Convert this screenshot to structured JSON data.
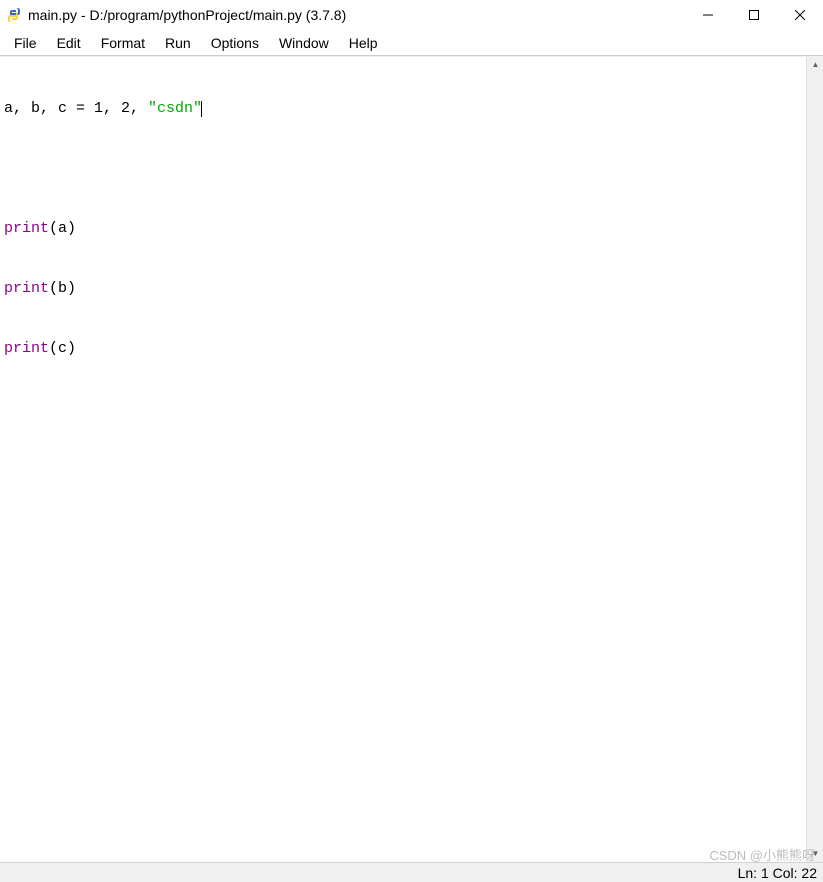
{
  "window": {
    "title": "main.py - D:/program/pythonProject/main.py (3.7.8)"
  },
  "menu": {
    "file": "File",
    "edit": "Edit",
    "format": "Format",
    "run": "Run",
    "options": "Options",
    "window": "Window",
    "help": "Help"
  },
  "code": {
    "line1_pre": "a, b, c = 1, 2, ",
    "line1_str": "\"csdn\"",
    "line3_fn": "print",
    "line3_arg": "(a)",
    "line4_fn": "print",
    "line4_arg": "(b)",
    "line5_fn": "print",
    "line5_arg": "(c)"
  },
  "status": {
    "position": "Ln: 1  Col: 22"
  },
  "watermark": "CSDN @小熊熊呀"
}
